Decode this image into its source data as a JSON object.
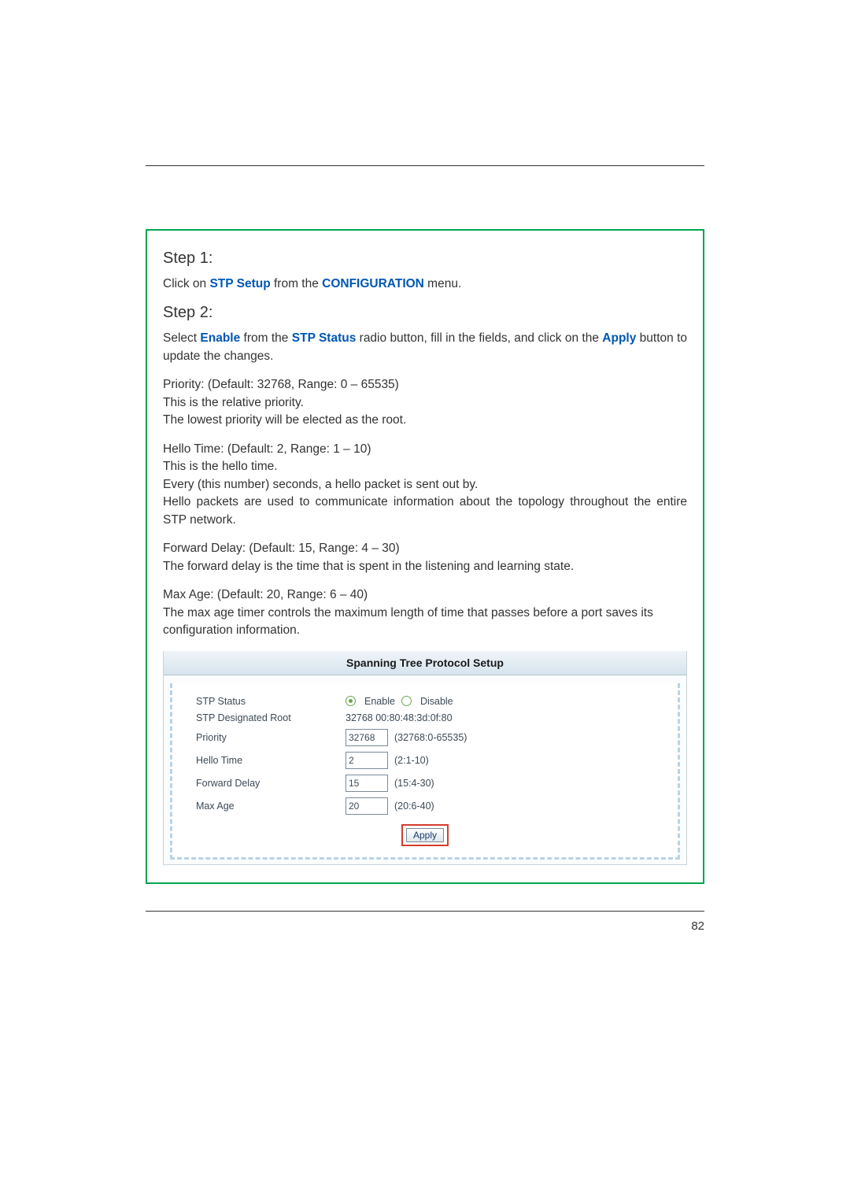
{
  "step1": {
    "heading": "Step 1:",
    "text_pre": "Click on ",
    "link1": "STP Setup",
    "text_mid": " from the ",
    "link2": "CONFIGURATION",
    "text_post": " menu."
  },
  "step2": {
    "heading": "Step 2:",
    "text_pre": "Select ",
    "link1": "Enable",
    "text_mid1": " from the ",
    "link2": "STP Status",
    "text_mid2": " radio button, fill in the fields, and click on the ",
    "link3": "Apply",
    "text_post": " button to update the changes."
  },
  "paragraphs": {
    "priority_l1": "Priority: (Default: 32768, Range: 0 – 65535)",
    "priority_l2": "This is the relative priority.",
    "priority_l3": "The lowest priority will be elected as the root.",
    "hello_l1": "Hello Time: (Default: 2, Range: 1 – 10)",
    "hello_l2": "This is the hello time.",
    "hello_l3": "Every (this number) seconds, a hello packet is sent out by.",
    "hello_l4": "Hello packets are used to communicate information about the topology throughout the entire STP network.",
    "fwd_l1": "Forward Delay: (Default: 15, Range: 4 – 30)",
    "fwd_l2": "The forward delay is the time that is spent in the listening and learning state.",
    "max_l1": "Max Age: (Default: 20, Range: 6 – 40)",
    "max_l2": "The max age timer controls the maximum length of time that passes before a port saves its configuration information."
  },
  "screenshot": {
    "title": "Spanning Tree Protocol Setup",
    "rows": {
      "status_label": "STP Status",
      "status_enable": "Enable",
      "status_disable": "Disable",
      "root_label": "STP Designated Root",
      "root_value": "32768 00:80:48:3d:0f:80",
      "priority_label": "Priority",
      "priority_value": "32768",
      "priority_hint": "(32768:0-65535)",
      "hello_label": "Hello Time",
      "hello_value": "2",
      "hello_hint": "(2:1-10)",
      "fwd_label": "Forward Delay",
      "fwd_value": "15",
      "fwd_hint": "(15:4-30)",
      "max_label": "Max Age",
      "max_value": "20",
      "max_hint": "(20:6-40)"
    },
    "apply_label": "Apply"
  },
  "page_number": "82"
}
